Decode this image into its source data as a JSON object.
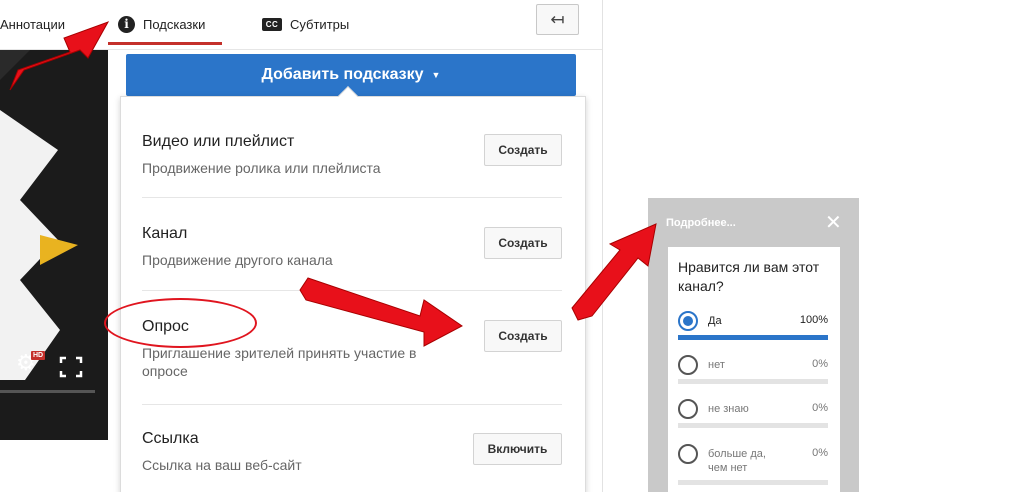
{
  "tabs": {
    "annotations": "Аннотации",
    "cards": "Подсказки",
    "subtitles": "Субтитры",
    "cards_icon": "i",
    "cc_icon": "CC",
    "back_icon": "↤"
  },
  "add_button": {
    "label": "Добавить подсказку",
    "caret": "▼"
  },
  "options": [
    {
      "title": "Видео или плейлист",
      "desc": "Продвижение ролика или плейлиста",
      "button": "Создать"
    },
    {
      "title": "Канал",
      "desc": "Продвижение другого канала",
      "button": "Создать"
    },
    {
      "title": "Опрос",
      "desc": "Приглашение зрителей принять участие в опросе",
      "button": "Создать"
    },
    {
      "title": "Ссылка",
      "desc": "Ссылка на ваш веб-сайт",
      "button": "Включить"
    }
  ],
  "video": {
    "hd_badge": "HD",
    "gear_icon": "⚙"
  },
  "poll_card": {
    "more": "Подробнее...",
    "close_icon": "✕",
    "question": "Нравится ли вам этот канал?",
    "answers": [
      {
        "label": "Да",
        "percent": "100%",
        "share": 1.0,
        "selected": true
      },
      {
        "label": "нет",
        "percent": "0%",
        "share": 0,
        "selected": false
      },
      {
        "label": "не знаю",
        "percent": "0%",
        "share": 0,
        "selected": false
      },
      {
        "label": "больше да, чем нет",
        "percent": "0%",
        "share": 0,
        "selected": false
      }
    ]
  },
  "colors": {
    "accent": "#2b75c9",
    "tab_underline": "#c4302b",
    "arrow": "#e8101a"
  }
}
